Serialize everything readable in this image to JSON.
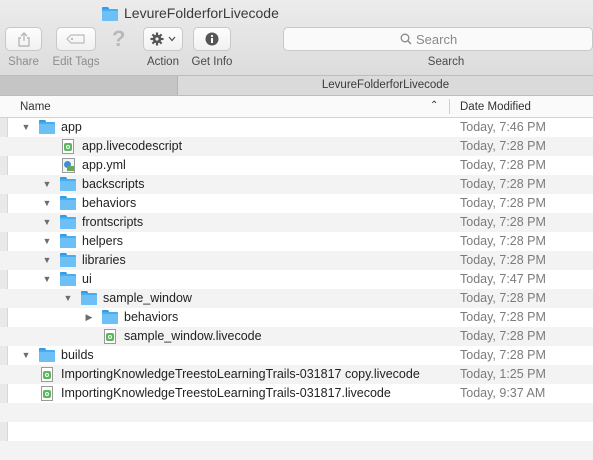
{
  "window": {
    "title": "LevureFolderforLivecode"
  },
  "toolbar": {
    "share_label": "Share",
    "edit_tags_label": "Edit Tags",
    "action_label": "Action",
    "get_info_label": "Get Info",
    "search_label": "Search",
    "search_placeholder": "Search"
  },
  "pathbar": {
    "tab_label": "LevureFolderforLivecode"
  },
  "columns": {
    "name": "Name",
    "date_modified": "Date Modified"
  },
  "rows": [
    {
      "name": "app",
      "date": "Today, 7:46 PM",
      "kind": "folder",
      "depth": 0,
      "disclosure": "open"
    },
    {
      "name": "app.livecodescript",
      "date": "Today, 7:28 PM",
      "kind": "livecode",
      "depth": 1,
      "disclosure": "none"
    },
    {
      "name": "app.yml",
      "date": "Today, 7:28 PM",
      "kind": "yml",
      "depth": 1,
      "disclosure": "none"
    },
    {
      "name": "backscripts",
      "date": "Today, 7:28 PM",
      "kind": "folder",
      "depth": 1,
      "disclosure": "open"
    },
    {
      "name": "behaviors",
      "date": "Today, 7:28 PM",
      "kind": "folder",
      "depth": 1,
      "disclosure": "open"
    },
    {
      "name": "frontscripts",
      "date": "Today, 7:28 PM",
      "kind": "folder",
      "depth": 1,
      "disclosure": "open"
    },
    {
      "name": "helpers",
      "date": "Today, 7:28 PM",
      "kind": "folder",
      "depth": 1,
      "disclosure": "open"
    },
    {
      "name": "libraries",
      "date": "Today, 7:28 PM",
      "kind": "folder",
      "depth": 1,
      "disclosure": "open"
    },
    {
      "name": "ui",
      "date": "Today, 7:47 PM",
      "kind": "folder",
      "depth": 1,
      "disclosure": "open"
    },
    {
      "name": "sample_window",
      "date": "Today, 7:28 PM",
      "kind": "folder",
      "depth": 2,
      "disclosure": "open"
    },
    {
      "name": "behaviors",
      "date": "Today, 7:28 PM",
      "kind": "folder",
      "depth": 3,
      "disclosure": "closed"
    },
    {
      "name": "sample_window.livecode",
      "date": "Today, 7:28 PM",
      "kind": "livecode",
      "depth": 3,
      "disclosure": "none"
    },
    {
      "name": "builds",
      "date": "Today, 7:28 PM",
      "kind": "folder",
      "depth": 0,
      "disclosure": "open"
    },
    {
      "name": "ImportingKnowledgeTreestoLearningTrails-031817 copy.livecode",
      "date": "Today, 1:25 PM",
      "kind": "livecode",
      "depth": 0,
      "disclosure": "none"
    },
    {
      "name": "ImportingKnowledgeTreestoLearningTrails-031817.livecode",
      "date": "Today, 9:37 AM",
      "kind": "livecode",
      "depth": 0,
      "disclosure": "none"
    }
  ]
}
